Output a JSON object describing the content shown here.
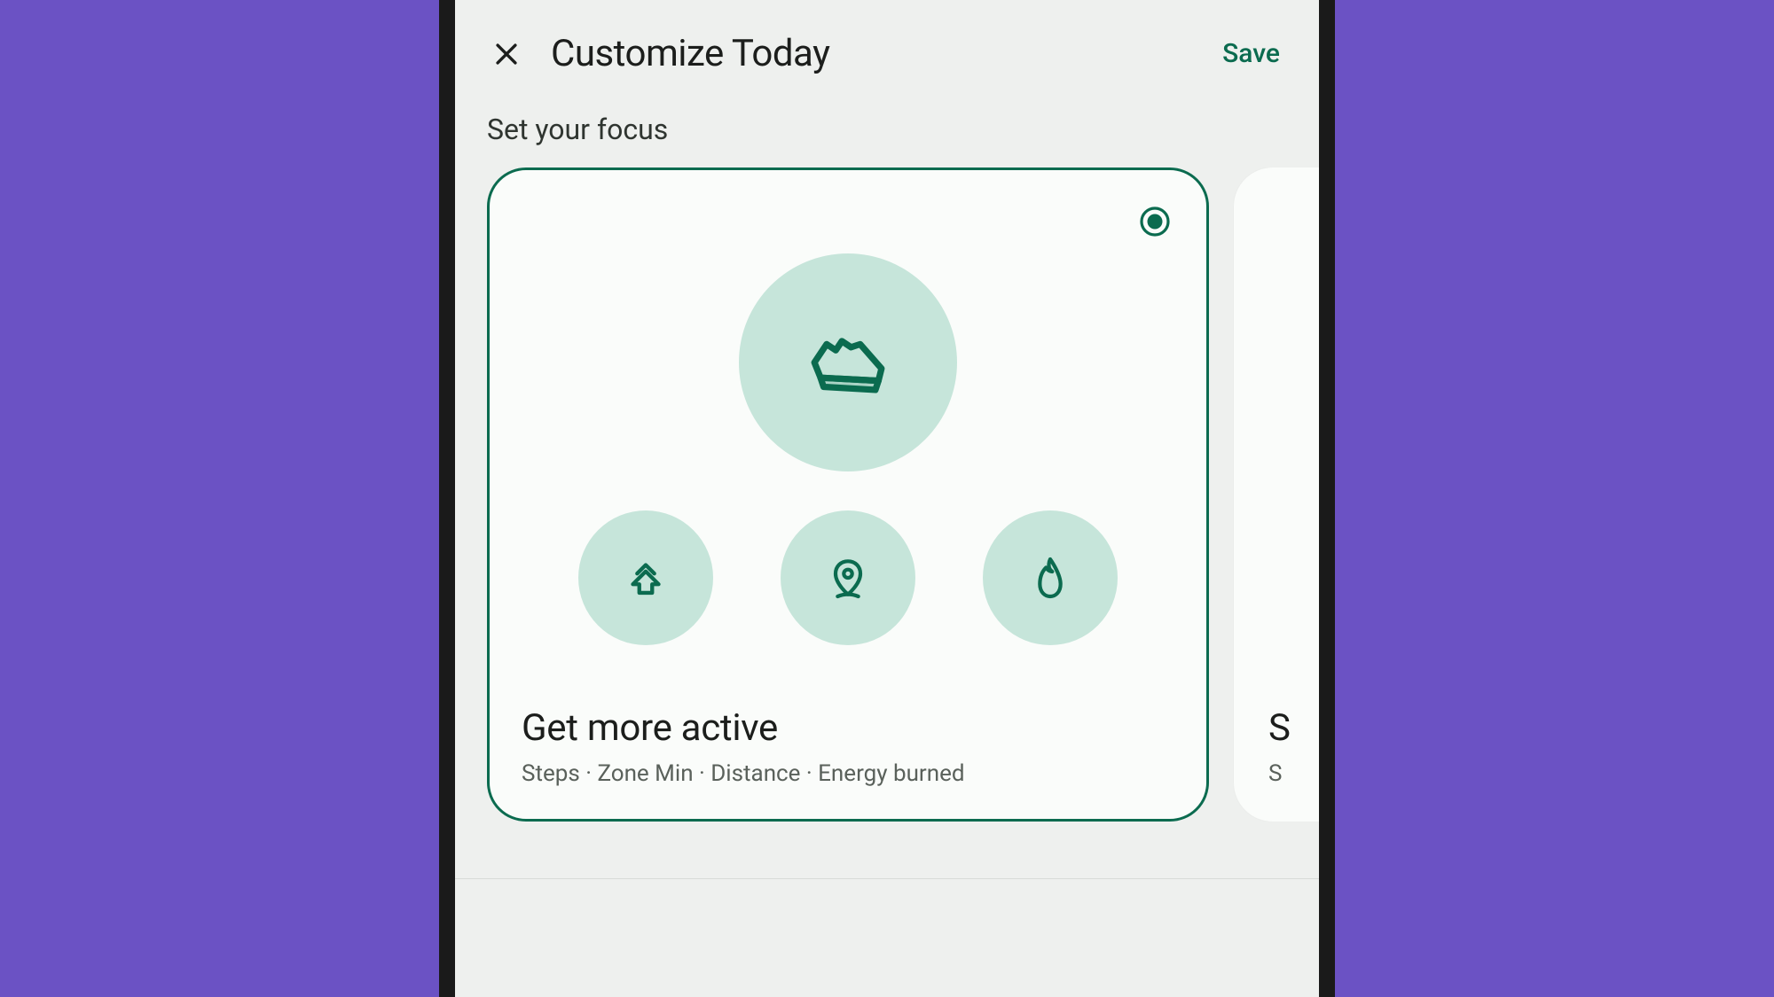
{
  "header": {
    "title": "Customize Today",
    "save_label": "Save"
  },
  "section_label": "Set your focus",
  "cards": [
    {
      "title": "Get more active",
      "subtitle": "Steps · Zone Min · Distance · Energy burned",
      "selected": true
    },
    {
      "title_initial": "S",
      "subtitle_initial": "S"
    }
  ],
  "colors": {
    "accent": "#0b6b4f",
    "icon_bg": "#c6e5da",
    "page_bg": "#6b52c4"
  }
}
